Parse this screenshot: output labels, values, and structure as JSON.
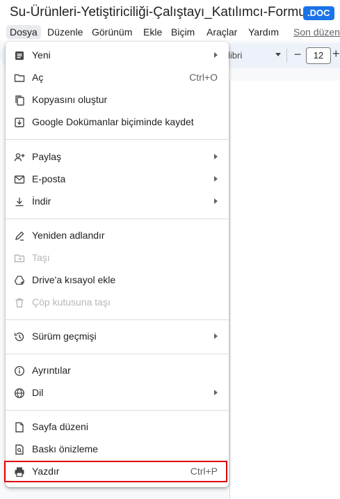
{
  "doc": {
    "title": "Su-Ürünleri-Yetiştiriciliği-Çalıştayı_Katılımcı-Formu",
    "badge": ".DOC"
  },
  "menubar": {
    "items": [
      "Dosya",
      "Düzenle",
      "Görünüm",
      "Ekle",
      "Biçim",
      "Araçlar",
      "Yardım"
    ],
    "last_edit": "Son düzen"
  },
  "toolbar": {
    "font": "libri",
    "font_size": "12",
    "minus": "−",
    "plus": "+"
  },
  "file_menu": {
    "groups": [
      [
        {
          "label": "Yeni",
          "icon": "document-icon",
          "submenu": true
        },
        {
          "label": "Aç",
          "icon": "folder-icon",
          "shortcut": "Ctrl+O"
        },
        {
          "label": "Kopyasını oluştur",
          "icon": "copy-icon"
        },
        {
          "label": "Google Dokümanlar biçiminde kaydet",
          "icon": "save-icon"
        }
      ],
      [
        {
          "label": "Paylaş",
          "icon": "share-person-icon",
          "submenu": true
        },
        {
          "label": "E-posta",
          "icon": "mail-icon",
          "submenu": true
        },
        {
          "label": "İndir",
          "icon": "download-icon",
          "submenu": true
        }
      ],
      [
        {
          "label": "Yeniden adlandır",
          "icon": "rename-icon"
        },
        {
          "label": "Taşı",
          "icon": "move-icon",
          "disabled": true
        },
        {
          "label": "Drive'a kısayol ekle",
          "icon": "drive-shortcut-icon"
        },
        {
          "label": "Çöp kutusuna taşı",
          "icon": "trash-icon",
          "disabled": true
        }
      ],
      [
        {
          "label": "Sürüm geçmişi",
          "icon": "history-icon",
          "submenu": true
        }
      ],
      [
        {
          "label": "Ayrıntılar",
          "icon": "info-icon"
        },
        {
          "label": "Dil",
          "icon": "globe-icon",
          "submenu": true
        }
      ],
      [
        {
          "label": "Sayfa düzeni",
          "icon": "page-setup-icon"
        },
        {
          "label": "Baskı önizleme",
          "icon": "print-preview-icon"
        },
        {
          "label": "Yazdır",
          "icon": "print-icon",
          "shortcut": "Ctrl+P",
          "highlighted": true
        }
      ]
    ]
  },
  "colors": {
    "accent": "#1a73e8",
    "highlight_border": "#e00000"
  }
}
